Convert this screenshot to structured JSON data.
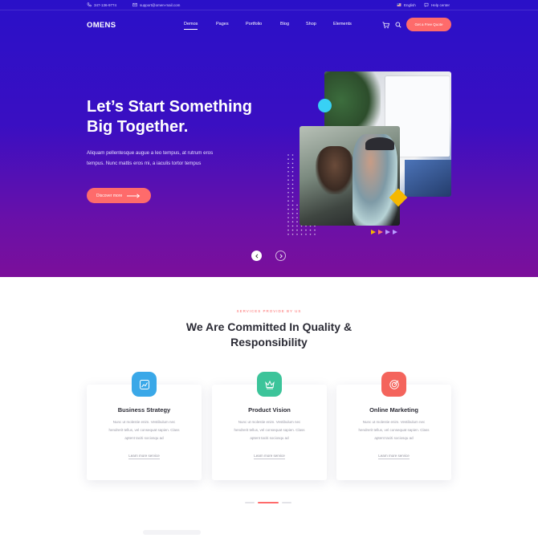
{
  "topbar": {
    "phone": "347-136-9774",
    "email": "support@omen-mail.com",
    "language": "English",
    "help": "Help center"
  },
  "nav": {
    "logo": "OMENS",
    "items": [
      {
        "label": "Demos"
      },
      {
        "label": "Pages"
      },
      {
        "label": "Portfolio"
      },
      {
        "label": "Blog"
      },
      {
        "label": "Shop"
      },
      {
        "label": "Elements"
      }
    ],
    "quote_button": "Get a Free Quote"
  },
  "hero": {
    "title_line1": "Let’s Start Something",
    "title_line2": "Big Together.",
    "desc_line1": "Aliquam pellentesque augue a leo tempus, at rutrum eros",
    "desc_line2": "tempus. Nunc mattis eros mi, a iaculis tortor tempus",
    "button": "Discover more"
  },
  "services": {
    "subtitle": "SERVICES PROVIDE BY US",
    "title_line1": "We Are Committed In Quality &",
    "title_line2": "Responsibility",
    "cards": [
      {
        "title": "Business Strategy",
        "text_line1": "Nunc ut molestie enim. Vestibulum nec",
        "text_line2": "hendrerit tellus, vel consequat sapien. Class",
        "text_line3": "aptent taciti sociosqu ad",
        "link": "Learn more service",
        "icon": "chart-icon",
        "color": "#3aa8e8"
      },
      {
        "title": "Product Vision",
        "text_line1": "Nunc ut molestie enim. Vestibulum nec",
        "text_line2": "hendrerit tellus, vel consequat sapien. Class",
        "text_line3": "aptent taciti sociosqu ad",
        "link": "Learn more service",
        "icon": "crown-icon",
        "color": "#3cc49a"
      },
      {
        "title": "Online Marketing",
        "text_line1": "Nunc ut molestie enim. Vestibulum nec",
        "text_line2": "hendrerit tellus, vel consequat sapien. Class",
        "text_line3": "aptent taciti sociosqu ad",
        "link": "Learn more service",
        "icon": "target-icon",
        "color": "#f4645c"
      }
    ]
  },
  "colors": {
    "accent": "#fe6b6b",
    "hero_top": "#2a10c8",
    "hero_bottom": "#7b0f9a"
  }
}
